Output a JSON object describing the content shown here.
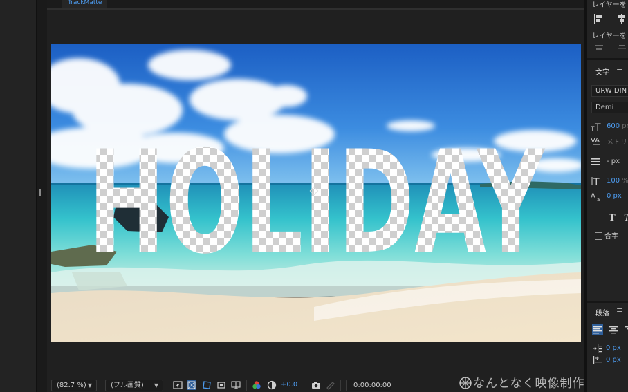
{
  "viewer": {
    "tab_label": "TrackMatte",
    "canvas_text": "HOLIDAY"
  },
  "toolbar": {
    "zoom": "(82.7 %)",
    "resolution": "(フル画質)",
    "exposure": "+0.0",
    "timecode": "0:00:00:00"
  },
  "align_panel": {
    "align_layers_label": "レイヤーを",
    "distribute_layers_label": "レイヤーを"
  },
  "character_panel": {
    "title": "文字",
    "font_family": "URW DIN C",
    "font_style": "Demi",
    "font_size": "600",
    "font_size_unit": "px",
    "kerning": "メトリ",
    "leading": "- px",
    "vertical_scale": "100",
    "vertical_scale_unit": "%",
    "baseline_shift": "0 px",
    "ligature_label": "合字"
  },
  "paragraph_panel": {
    "title": "段落",
    "indent_left": "0 px",
    "indent_first": "0 px"
  },
  "watermark": "なんとなく映像制作",
  "colors": {
    "accent_blue": "#4d9cf0",
    "panel_bg": "#232323",
    "viewer_bg": "#202020"
  }
}
